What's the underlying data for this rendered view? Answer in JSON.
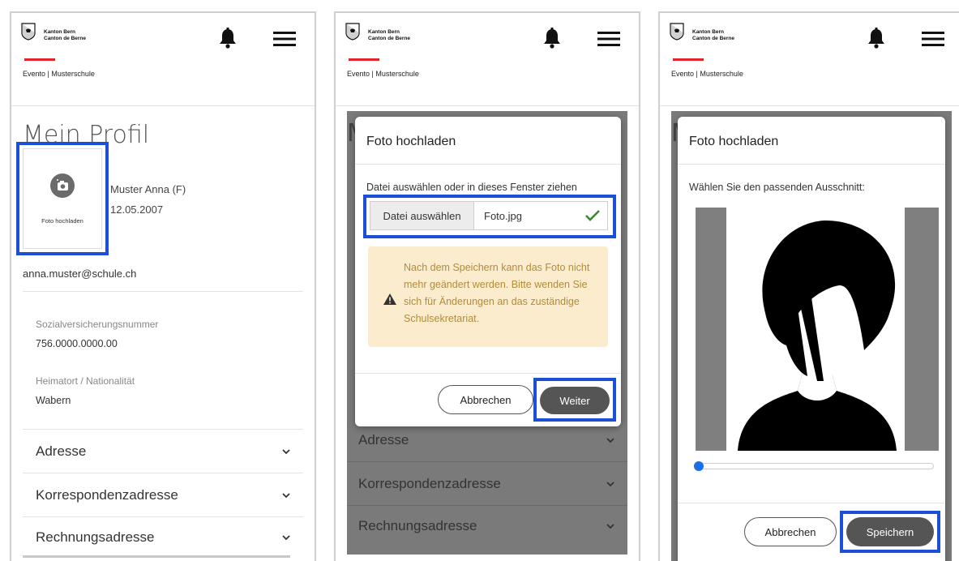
{
  "header": {
    "brand_line1": "Kanton Bern",
    "brand_line2": "Canton de Berne",
    "breadcrumb": "Evento | Musterschule"
  },
  "profile": {
    "title": "Mein Profil",
    "photo_label": "Foto hochladen",
    "name": "Muster Anna (F)",
    "dob": "12.05.2007",
    "email": "anna.muster@schule.ch",
    "fields": [
      {
        "label": "Sozialversicherungsnummer",
        "value": "756.0000.0000.00"
      },
      {
        "label": "Heimatort / Nationalität",
        "value": "Wabern"
      }
    ],
    "accordions": [
      "Adresse",
      "Korrespondenzadresse",
      "Rechnungsadresse"
    ]
  },
  "upload_dialog": {
    "title": "Foto hochladen",
    "hint": "Datei auswählen oder in dieses Fenster ziehen",
    "choose_button": "Datei auswählen",
    "file_name": "Foto.jpg",
    "warning": "Nach dem Speichern kann das Foto nicht mehr geändert werden. Bitte wenden Sie sich für Änderungen an das zuständige Schulsekretariat.",
    "cancel": "Abbrechen",
    "next": "Weiter"
  },
  "crop_dialog": {
    "title": "Foto hochladen",
    "hint": "Wählen Sie den passenden Ausschnitt:",
    "cancel": "Abbrechen",
    "save": "Speichern",
    "zoom_level": 0.0
  },
  "colors": {
    "highlight": "#1a4fd6",
    "brand_red": "#e3242b",
    "warning_bg": "#fcecce",
    "warning_text": "#b08b3a",
    "primary_button": "#555555",
    "success": "#3a8a2a"
  },
  "icons": [
    "bern-crest-icon",
    "bell-icon",
    "hamburger-menu-icon",
    "camera-icon",
    "chevron-down-icon",
    "checkmark-icon",
    "warning-icon"
  ]
}
